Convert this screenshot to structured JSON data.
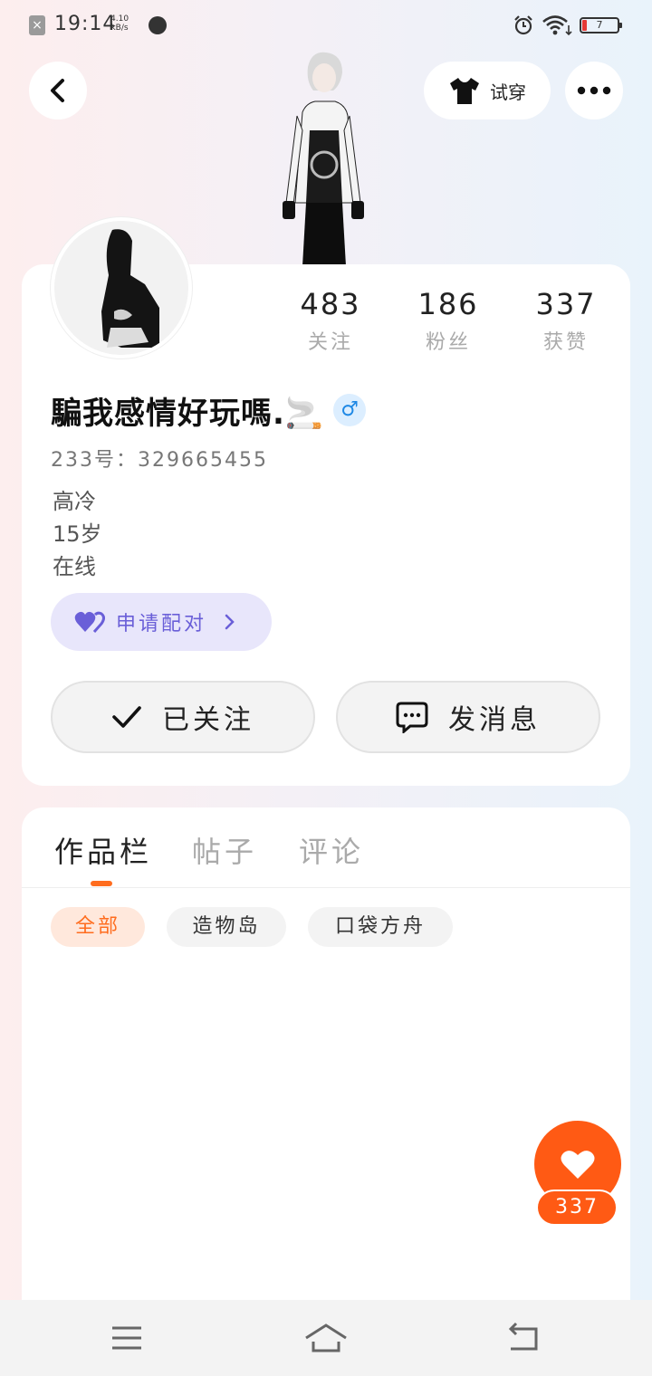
{
  "status_bar": {
    "time": "19:14",
    "speed_value": "4.10",
    "speed_unit": "kB/s",
    "battery": "7",
    "icons": [
      "close-icon",
      "planet-icon",
      "alarm-icon",
      "wifi-icon",
      "battery-icon"
    ]
  },
  "header": {
    "tryon_label": "试穿"
  },
  "profile": {
    "stats": [
      {
        "value": "483",
        "label": "关注"
      },
      {
        "value": "186",
        "label": "粉丝"
      },
      {
        "value": "337",
        "label": "获赞"
      }
    ],
    "nickname": "騙我感情好玩嗎.🚬",
    "gender": "♂",
    "uid": "233号：329665455",
    "bio": [
      "高冷",
      "15岁",
      "在线"
    ],
    "pair_label": "申请配对",
    "follow_label": "已关注",
    "message_label": "发消息"
  },
  "tabs": [
    "作品栏",
    "帖子",
    "评论"
  ],
  "filters": [
    "全部",
    "造物岛",
    "口袋方舟"
  ],
  "like_count": "337",
  "colors": {
    "accent": "#ff5a14",
    "pair": "#6a5fd8",
    "gender": "#1e88e5"
  }
}
